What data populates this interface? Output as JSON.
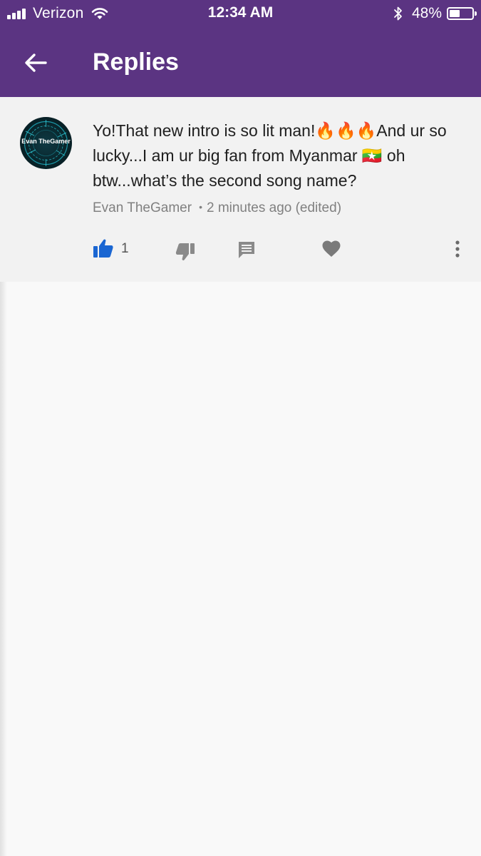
{
  "status_bar": {
    "carrier": "Verizon",
    "time": "12:34 AM",
    "battery_pct": "48%",
    "battery_level": 0.48
  },
  "app_bar": {
    "title": "Replies",
    "back_icon": "arrow-left-icon"
  },
  "comment": {
    "text": "Yo!That new intro is so lit man!🔥🔥🔥And ur so lucky...I am ur big fan from Myanmar 🇲🇲 oh btw...what’s the second song name?",
    "author": "Evan TheGamer",
    "separator": "•",
    "time": "2 minutes ago (edited)",
    "avatar_text": "Evan TheGamer",
    "like_count": "1"
  },
  "icons": {
    "like": "thumbs-up-icon",
    "dislike": "thumbs-down-icon",
    "reply": "comment-icon",
    "heart": "heart-icon",
    "more": "more-vertical-icon"
  },
  "colors": {
    "app_bar": "#5b3482",
    "like_active": "#1a66d2",
    "icon_gray": "#8a8a8a",
    "card_bg": "#f2f2f2",
    "page_bg": "#f9f9f9"
  }
}
